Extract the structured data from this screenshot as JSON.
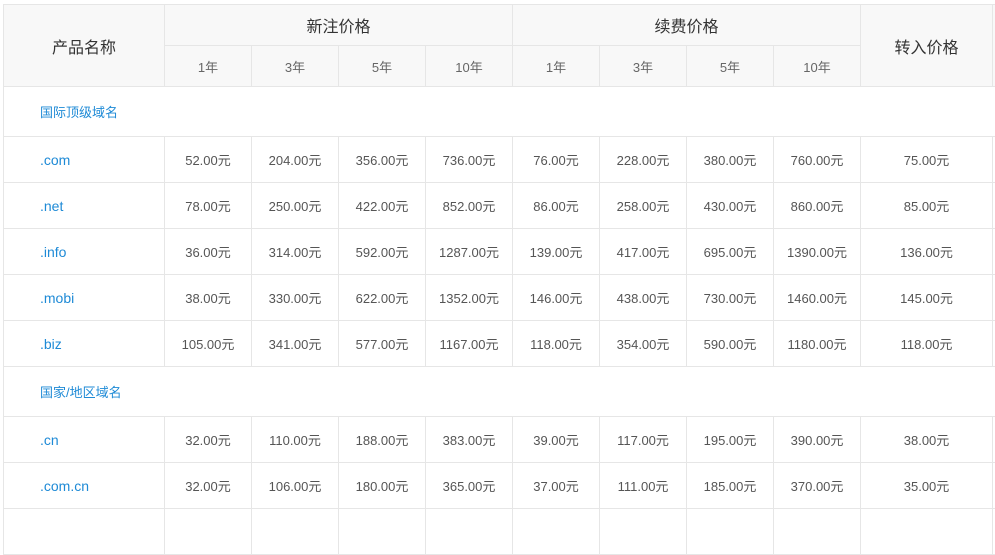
{
  "header": {
    "product_name": "产品名称",
    "new_price": "新注价格",
    "renew_price": "续费价格",
    "transfer_price": "转入价格",
    "periods": [
      "1年",
      "3年",
      "5年",
      "10年"
    ]
  },
  "sections": [
    {
      "title": "国际顶级域名",
      "rows": [
        {
          "name": ".com",
          "new": [
            "52.00元",
            "204.00元",
            "356.00元",
            "736.00元"
          ],
          "renew": [
            "76.00元",
            "228.00元",
            "380.00元",
            "760.00元"
          ],
          "transfer": "75.00元"
        },
        {
          "name": ".net",
          "new": [
            "78.00元",
            "250.00元",
            "422.00元",
            "852.00元"
          ],
          "renew": [
            "86.00元",
            "258.00元",
            "430.00元",
            "860.00元"
          ],
          "transfer": "85.00元"
        },
        {
          "name": ".info",
          "new": [
            "36.00元",
            "314.00元",
            "592.00元",
            "1287.00元"
          ],
          "renew": [
            "139.00元",
            "417.00元",
            "695.00元",
            "1390.00元"
          ],
          "transfer": "136.00元"
        },
        {
          "name": ".mobi",
          "new": [
            "38.00元",
            "330.00元",
            "622.00元",
            "1352.00元"
          ],
          "renew": [
            "146.00元",
            "438.00元",
            "730.00元",
            "1460.00元"
          ],
          "transfer": "145.00元"
        },
        {
          "name": ".biz",
          "new": [
            "105.00元",
            "341.00元",
            "577.00元",
            "1167.00元"
          ],
          "renew": [
            "118.00元",
            "354.00元",
            "590.00元",
            "1180.00元"
          ],
          "transfer": "118.00元"
        }
      ]
    },
    {
      "title": "国家/地区域名",
      "rows": [
        {
          "name": ".cn",
          "new": [
            "32.00元",
            "110.00元",
            "188.00元",
            "383.00元"
          ],
          "renew": [
            "39.00元",
            "117.00元",
            "195.00元",
            "390.00元"
          ],
          "transfer": "38.00元"
        },
        {
          "name": ".com.cn",
          "new": [
            "32.00元",
            "106.00元",
            "180.00元",
            "365.00元"
          ],
          "renew": [
            "37.00元",
            "111.00元",
            "185.00元",
            "370.00元"
          ],
          "transfer": "35.00元"
        }
      ]
    }
  ]
}
